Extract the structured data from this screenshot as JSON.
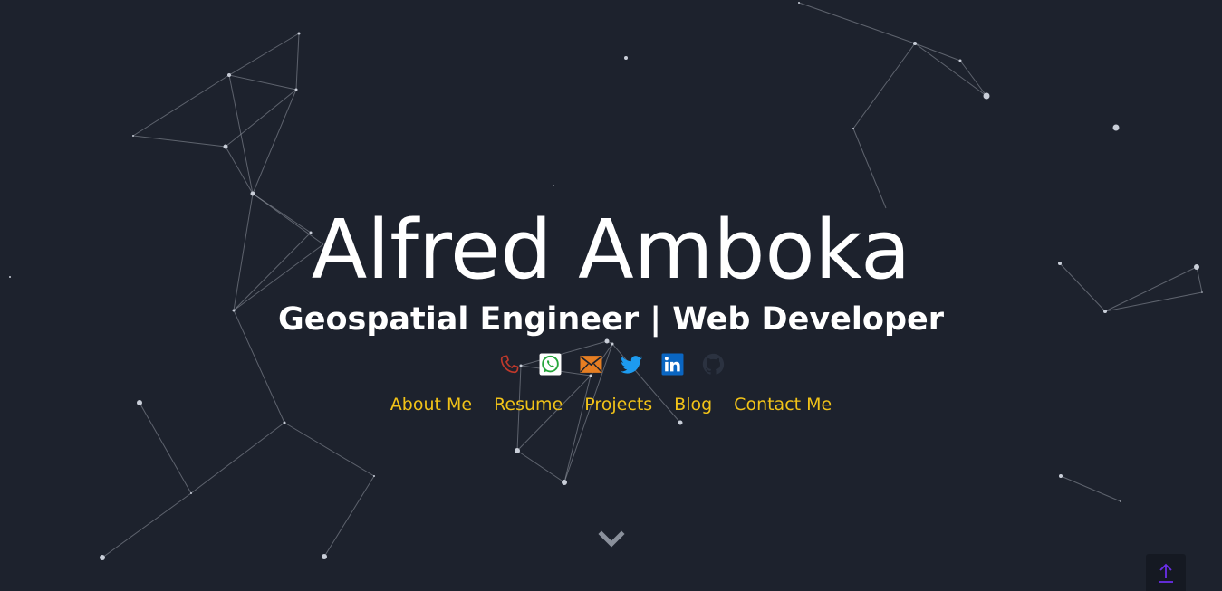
{
  "hero": {
    "name": "Alfred Amboka",
    "subtitle": "Geospatial Engineer | Web Developer"
  },
  "social": [
    {
      "icon": "phone-icon",
      "color": "#c0392b"
    },
    {
      "icon": "whatsapp-icon",
      "color": "#25a53a"
    },
    {
      "icon": "email-icon",
      "color": "#e67e22"
    },
    {
      "icon": "twitter-icon",
      "color": "#1d9bf0"
    },
    {
      "icon": "linkedin-icon",
      "color": "#0a66c2"
    },
    {
      "icon": "github-icon",
      "color": "#2b3240"
    }
  ],
  "nav": {
    "about": "About Me",
    "resume": "Resume",
    "projects": "Projects",
    "blog": "Blog",
    "contact": "Contact Me"
  },
  "colors": {
    "background": "#1d222d",
    "text": "#ffffff",
    "nav_link": "#f2c318",
    "scroll_button_arrow": "#6a2ee8"
  },
  "controls": {
    "scroll_down_icon": "chevron-down-icon",
    "back_to_top_icon": "arrow-up-icon"
  }
}
